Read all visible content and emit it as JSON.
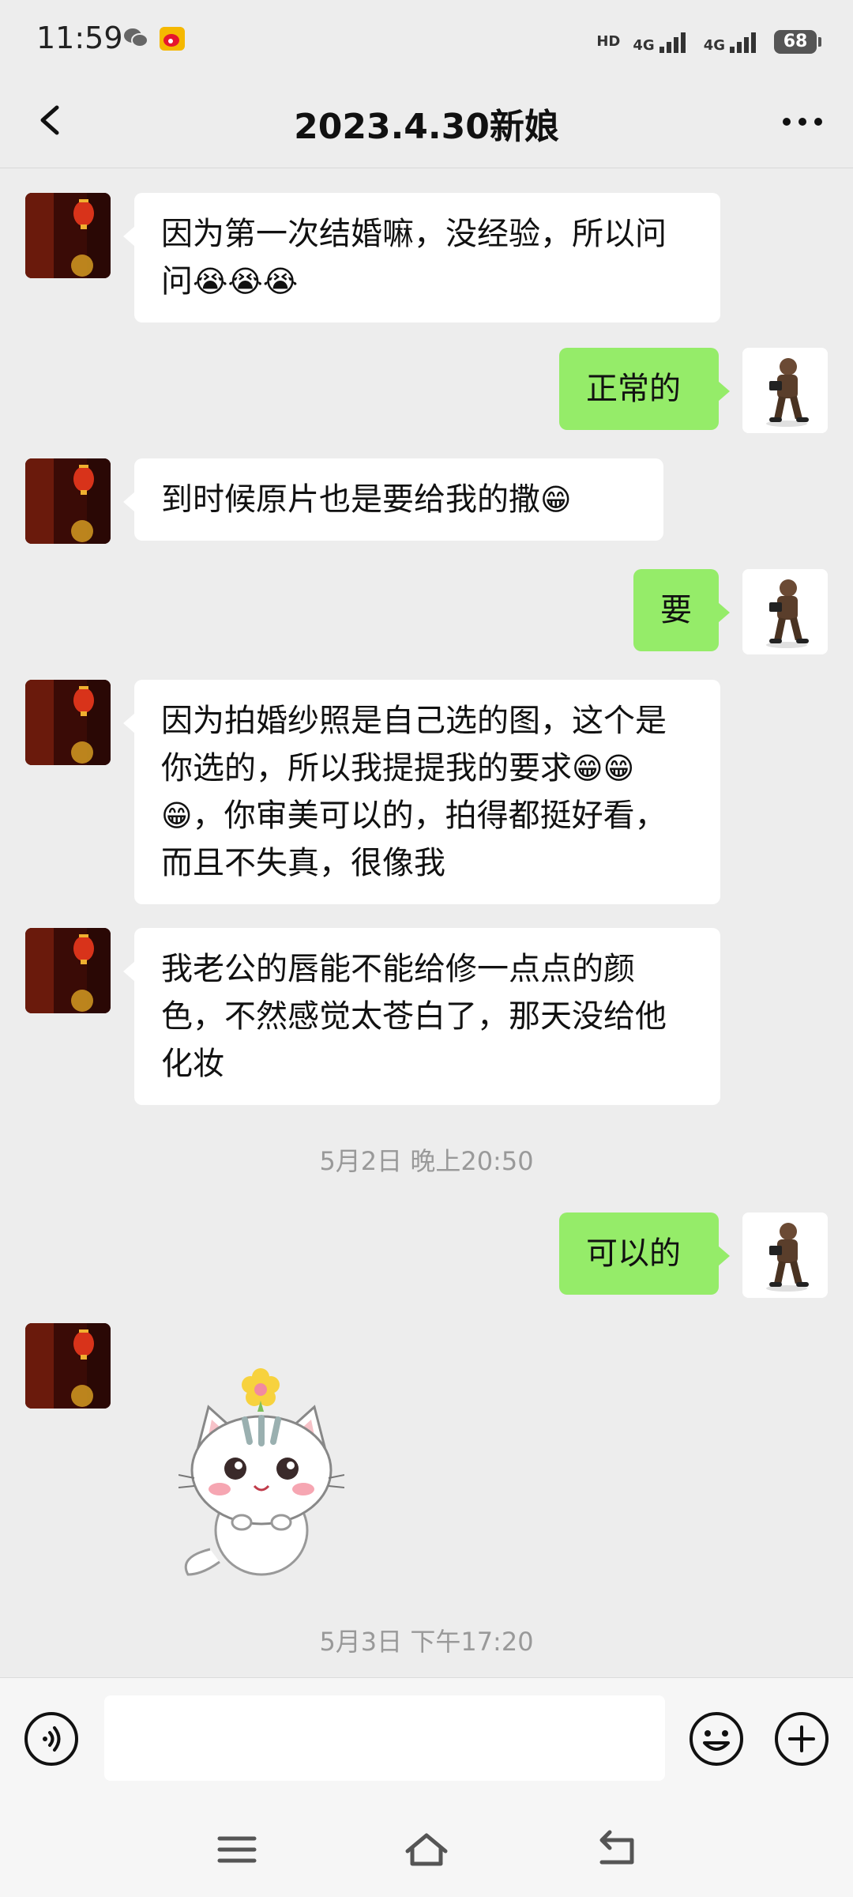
{
  "status": {
    "time": "11:59",
    "network_labels": [
      "HD",
      "4G",
      "4G"
    ],
    "battery": "68"
  },
  "header": {
    "title": "2023.4.30新娘"
  },
  "messages": [
    {
      "side": "left",
      "text": "因为第一次结婚嘛，没经验，所以问问",
      "emojis": "😭😭😭"
    },
    {
      "side": "right",
      "text": "正常的"
    },
    {
      "side": "left",
      "text": "到时候原片也是要给我的撒",
      "emojis": "😁"
    },
    {
      "side": "right",
      "text": "要"
    },
    {
      "side": "left",
      "text_a": "因为拍婚纱照是自己选的图，这个是你选的，所以我提提我的要求",
      "emojis_a": "😁",
      "emojis_b": "😁😁",
      "text_b": "，你审美可以的，拍得都挺好看，而且不失真，很像我"
    },
    {
      "side": "left",
      "text": "我老公的唇能不能给修一点点的颜色，不然感觉太苍白了，那天没给他化妆"
    },
    {
      "side": "right",
      "text": "可以的"
    },
    {
      "side": "left",
      "sticker": "cat-sticker"
    }
  ],
  "timestamps": [
    "5月2日 晚上20:50",
    "5月3日 下午17:20"
  ],
  "colors": {
    "background": "#ededed",
    "sent_bubble": "#95ec69",
    "received_bubble": "#ffffff"
  }
}
